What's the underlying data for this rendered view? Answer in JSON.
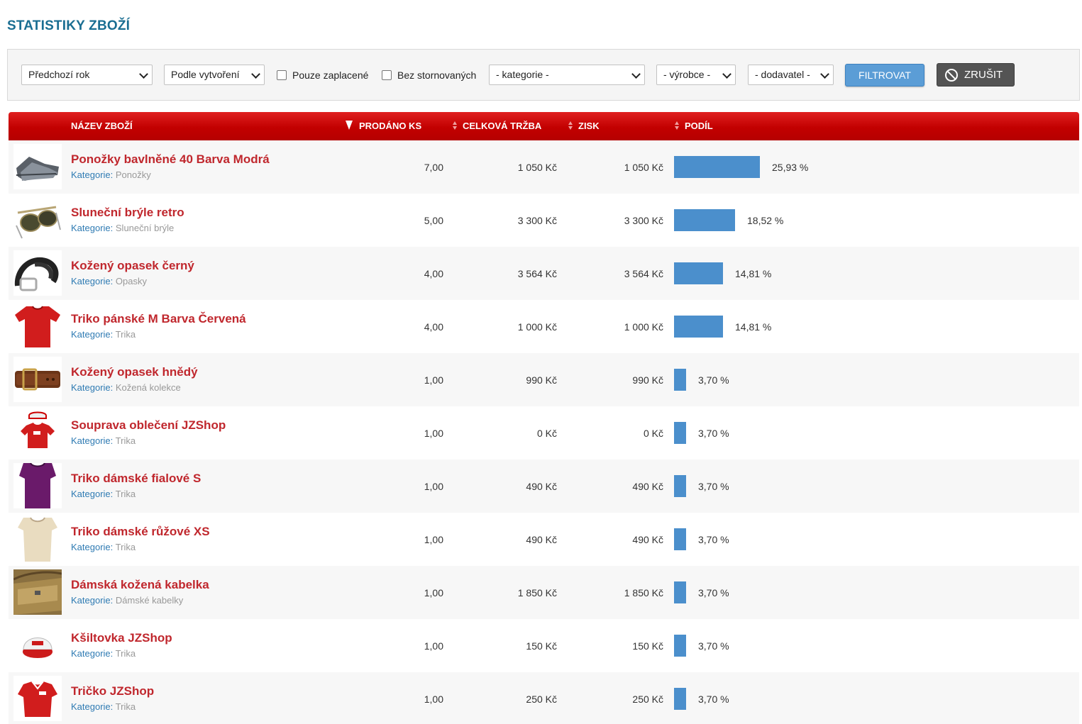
{
  "page": {
    "title": "STATISTIKY ZBOŽÍ"
  },
  "filters": {
    "period": "Předchozí rok",
    "date_mode": "Podle vytvoření",
    "paid_only_label": "Pouze zaplacené",
    "no_cancelled_label": "Bez stornovaných",
    "category": "- kategorie -",
    "manufacturer": "- výrobce -",
    "supplier": "- dodavatel -",
    "filter_button": "FILTROVAT",
    "cancel_button": "ZRUŠIT"
  },
  "table": {
    "headers": {
      "name": "NÁZEV ZBOŽÍ",
      "sold": "PRODÁNO KS",
      "revenue": "CELKOVÁ TRŽBA",
      "profit": "ZISK",
      "share": "PODÍL"
    },
    "category_prefix": "Kategorie:",
    "rows": [
      {
        "name": "Ponožky bavlněné 40 Barva Modrá",
        "category": "Ponožky",
        "sold": "7,00",
        "revenue": "1 050 Kč",
        "profit": "1 050 Kč",
        "share": "25,93 %",
        "share_value": 25.93,
        "image": "socks"
      },
      {
        "name": "Sluneční brýle retro",
        "category": "Sluneční brýle",
        "sold": "5,00",
        "revenue": "3 300 Kč",
        "profit": "3 300 Kč",
        "share": "18,52 %",
        "share_value": 18.52,
        "image": "sunglasses"
      },
      {
        "name": "Kožený opasek černý",
        "category": "Opasky",
        "sold": "4,00",
        "revenue": "3 564 Kč",
        "profit": "3 564 Kč",
        "share": "14,81 %",
        "share_value": 14.81,
        "image": "belt-black"
      },
      {
        "name": "Triko pánské M Barva Červená",
        "category": "Trika",
        "sold": "4,00",
        "revenue": "1 000 Kč",
        "profit": "1 000 Kč",
        "share": "14,81 %",
        "share_value": 14.81,
        "image": "tshirt-red"
      },
      {
        "name": "Kožený opasek hnědý",
        "category": "Kožená kolekce",
        "sold": "1,00",
        "revenue": "990 Kč",
        "profit": "990 Kč",
        "share": "3,70 %",
        "share_value": 3.7,
        "image": "belt-brown"
      },
      {
        "name": "Souprava oblečení JZShop",
        "category": "Trika",
        "sold": "1,00",
        "revenue": "0 Kč",
        "profit": "0 Kč",
        "share": "3,70 %",
        "share_value": 3.7,
        "image": "outfit-set"
      },
      {
        "name": "Triko dámské fialové S",
        "category": "Trika",
        "sold": "1,00",
        "revenue": "490 Kč",
        "profit": "490 Kč",
        "share": "3,70 %",
        "share_value": 3.7,
        "image": "tshirt-purple"
      },
      {
        "name": "Triko dámské růžové XS",
        "category": "Trika",
        "sold": "1,00",
        "revenue": "490 Kč",
        "profit": "490 Kč",
        "share": "3,70 %",
        "share_value": 3.7,
        "image": "tshirt-beige"
      },
      {
        "name": "Dámská kožená kabelka",
        "category": "Dámské kabelky",
        "sold": "1,00",
        "revenue": "1 850 Kč",
        "profit": "1 850 Kč",
        "share": "3,70 %",
        "share_value": 3.7,
        "image": "handbag"
      },
      {
        "name": "Kšiltovka JZShop",
        "category": "Trika",
        "sold": "1,00",
        "revenue": "150 Kč",
        "profit": "150 Kč",
        "share": "3,70 %",
        "share_value": 3.7,
        "image": "cap"
      },
      {
        "name": "Tričko JZShop",
        "category": "Trika",
        "sold": "1,00",
        "revenue": "250 Kč",
        "profit": "250 Kč",
        "share": "3,70 %",
        "share_value": 3.7,
        "image": "polo-red"
      }
    ]
  },
  "colors": {
    "accent": "#c20000",
    "title": "#1a6e92",
    "product_name": "#c0272d",
    "bar": "#4b8fcc",
    "filter_button": "#5b9dd6"
  }
}
